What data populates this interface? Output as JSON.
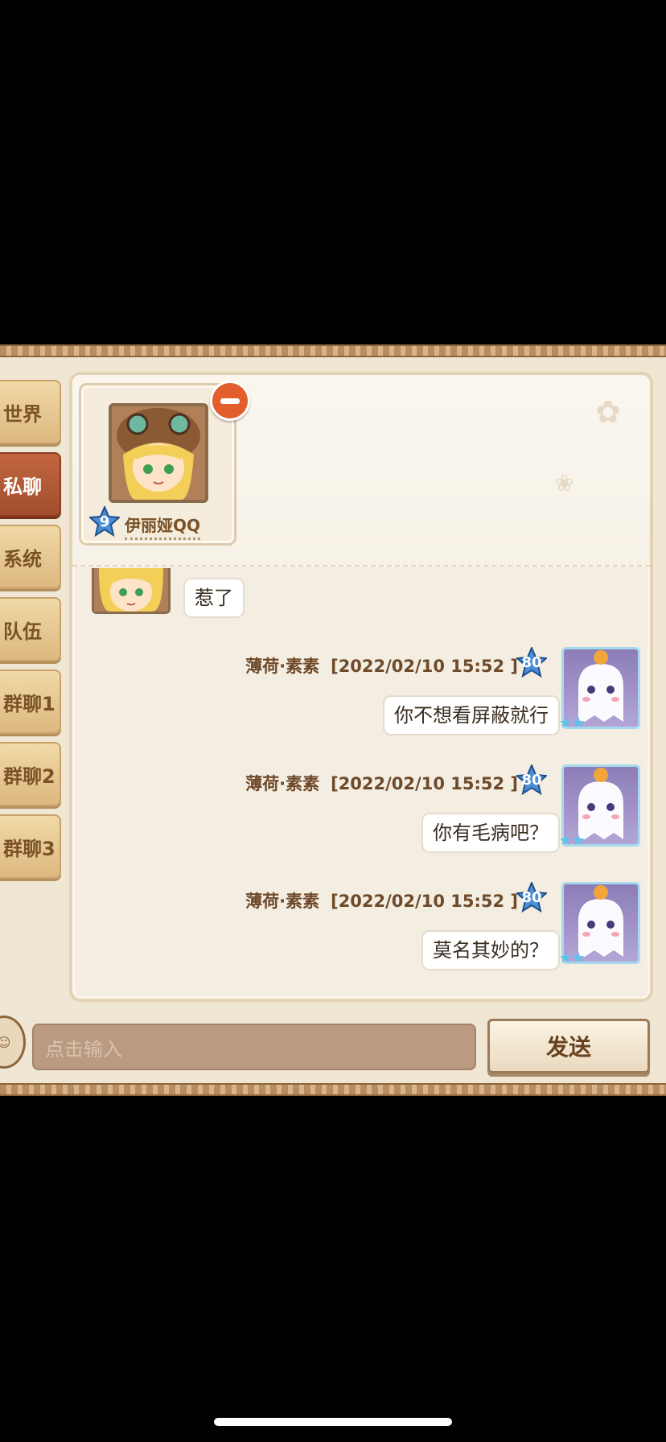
{
  "tabs": [
    "世界",
    "私聊",
    "系统",
    "队伍",
    "群聊1",
    "群聊2",
    "群聊3"
  ],
  "active_tab": "私聊",
  "contact": {
    "name": "伊丽娅QQ",
    "level": "9"
  },
  "messages": [
    {
      "side": "left",
      "text": "惹了"
    },
    {
      "side": "right",
      "sender": "薄荷·素素",
      "time": "[2022/02/10 15:52 ]",
      "level": "80",
      "text": "你不想看屏蔽就行"
    },
    {
      "side": "right",
      "sender": "薄荷·素素",
      "time": "[2022/02/10 15:52 ]",
      "level": "80",
      "text": "你有毛病吧？"
    },
    {
      "side": "right",
      "sender": "薄荷·素素",
      "time": "[2022/02/10 15:52 ]",
      "level": "80",
      "text": "莫名其妙的？"
    }
  ],
  "input": {
    "placeholder": "点击输入"
  },
  "send_label": "发送",
  "colors": {
    "active_tab": "#a24e2d",
    "tab": "#dcb880",
    "level_badge": "#4a8fd6"
  }
}
